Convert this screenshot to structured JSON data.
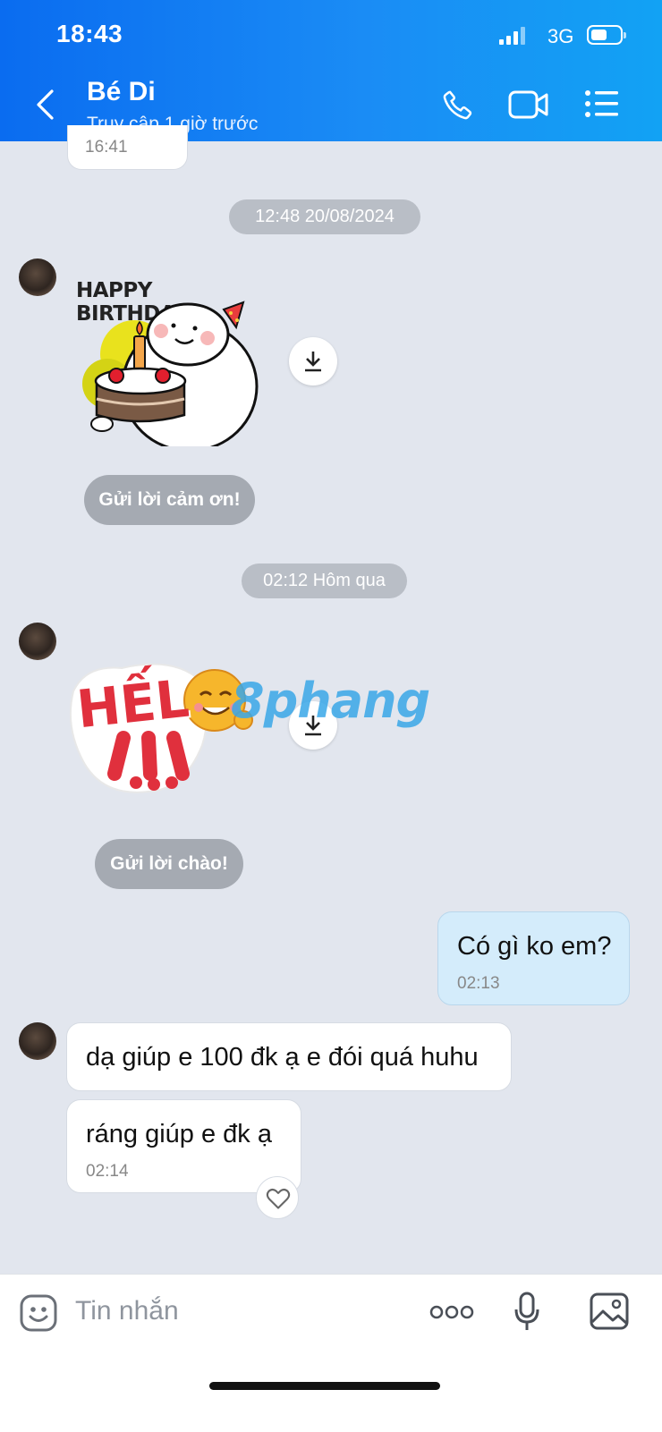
{
  "status_bar": {
    "time": "18:43",
    "network": "3G"
  },
  "header": {
    "contact_name": "Bé Di",
    "last_seen": "Truy cập 1 giờ trước"
  },
  "messages": {
    "prev_time": "16:41",
    "date_sep_1": "12:48 20/08/2024",
    "sticker_birthday_text": "HAPPY BIRTHDAY",
    "thanks_button": "Gửi lời cảm ơn!",
    "date_sep_2": "02:12 Hôm qua",
    "sticker_hello_text": "HẾL",
    "watermark": "8phang",
    "greet_button": "Gửi lời chào!",
    "sent_text": "Có gì ko em?",
    "sent_time": "02:13",
    "recv_1": "dạ giúp e 100 đk ạ e đói quá huhu",
    "recv_2": "ráng giúp e đk ạ",
    "recv_2_time": "02:14"
  },
  "composer": {
    "placeholder": "Tin nhắn"
  },
  "icons": {
    "back": "back-arrow-icon",
    "call": "phone-icon",
    "video": "video-camera-icon",
    "menu": "list-menu-icon",
    "download": "download-icon",
    "heart": "heart-icon",
    "emoji": "emoji-icon",
    "more": "more-dots-icon",
    "mic": "microphone-icon",
    "image": "image-icon"
  },
  "colors": {
    "header_start": "#0a6cf0",
    "header_end": "#12a2f4",
    "chat_bg": "#e2e6ee",
    "sent_bubble": "#d4ecfb"
  }
}
